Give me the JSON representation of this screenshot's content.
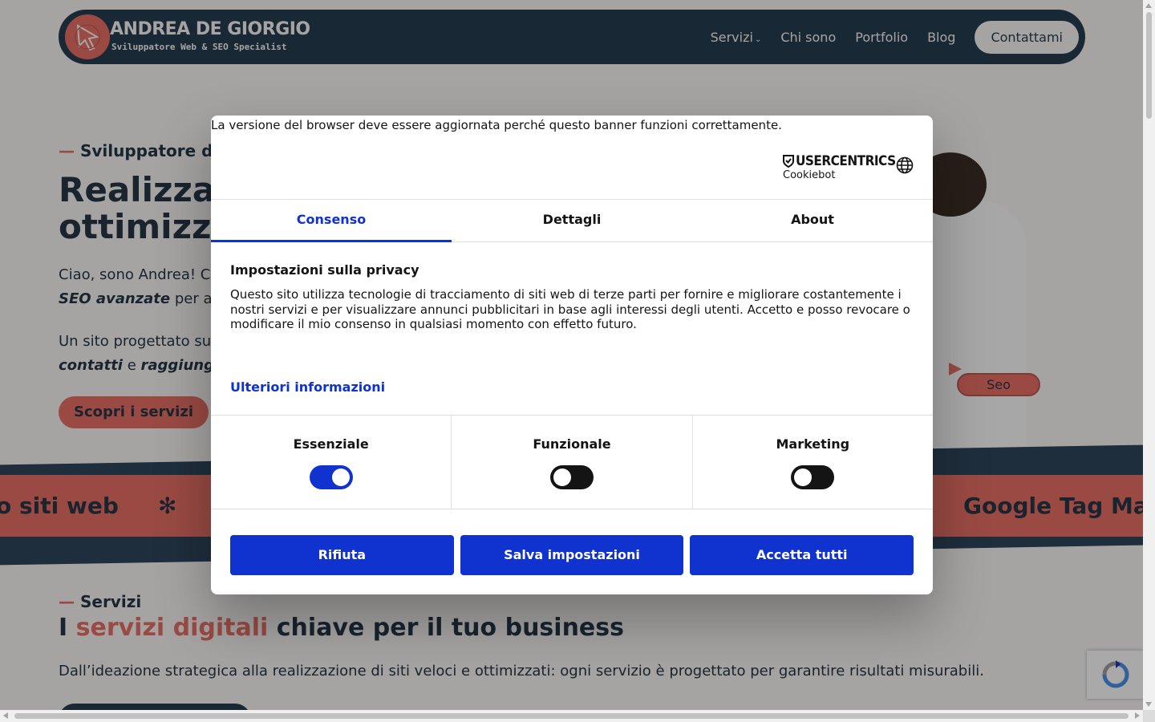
{
  "site": {
    "logo_title": "ANDREA DE GIORGIO",
    "logo_subtitle": "Sviluppatore Web & SEO Specialist",
    "nav": {
      "servizi": "Servizi",
      "chi_sono": "Chi sono",
      "portfolio": "Portfolio",
      "blog": "Blog",
      "cta": "Contattami"
    }
  },
  "hero": {
    "kicker_dash": "—",
    "kicker": "Sviluppatore d",
    "title_line1": "Realizzaz",
    "title_line2": "ottimizza",
    "p1_line1": "Ciao, sono Andrea! C",
    "p1_line2_em": "SEO avanzate",
    "p1_line2_rest": " per a",
    "p2_line1": "Un sito progettato su",
    "p2_line2_em1": "contatti",
    "p2_line2_mid": " e ",
    "p2_line2_em2": "raggiung",
    "button": "Scopri i servizi",
    "seo_tag": "Seo"
  },
  "marquee": {
    "left_text": "o siti web",
    "separator": "✻",
    "right_text": "Google Tag Ma"
  },
  "services": {
    "kicker_dash": "—",
    "kicker": "Servizi",
    "title_pre": "I ",
    "title_accent": "servizi digitali",
    "title_post": " chiave per il tuo business",
    "description": "Dall’ideazione strategica alla realizzazione di siti veloci e ottimizzati: ogni servizio è progettato per garantire risultati misurabili."
  },
  "cookie_dialog": {
    "browser_warning": "La versione del browser deve essere aggiornata perché questo banner funzioni correttamente.",
    "brand_name": "USERCENTRICS",
    "brand_sub": "Cookiebot",
    "tabs": [
      "Consenso",
      "Dettagli",
      "About"
    ],
    "active_tab": "Consenso",
    "privacy_title": "Impostazioni sulla privacy",
    "privacy_text": "Questo sito utilizza tecnologie di tracciamento di siti web di terze parti per fornire e migliorare costantemente i nostri servizi e per visualizzare annunci pubblicitari in base agli interessi degli utenti. Accetto e posso revocare o modificare il mio consenso in qualsiasi momento con effetto futuro.",
    "more_info": "Ulteriori informazioni",
    "categories": [
      {
        "label": "Essenziale",
        "enabled": true
      },
      {
        "label": "Funzionale",
        "enabled": false
      },
      {
        "label": "Marketing",
        "enabled": false
      }
    ],
    "buttons": {
      "reject": "Rifiuta",
      "save": "Salva impostazioni",
      "accept_all": "Accetta tutti"
    }
  },
  "colors": {
    "brand_dark": "#263b4e",
    "brand_coral": "#e36d63",
    "cookie_blue": "#1032cf"
  }
}
